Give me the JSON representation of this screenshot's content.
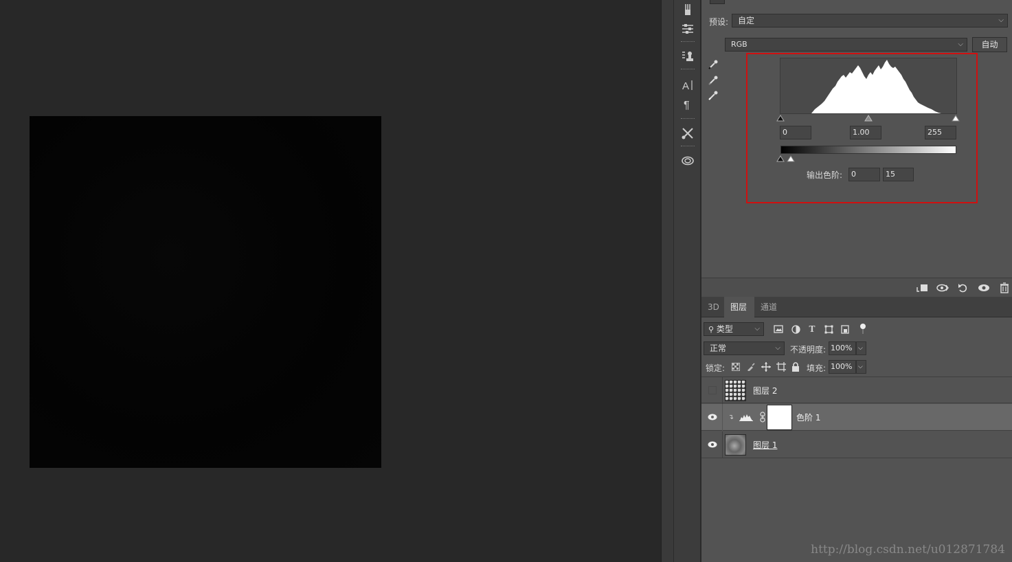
{
  "properties": {
    "preset_label": "预设:",
    "preset_value": "自定",
    "channel_value": "RGB",
    "auto_button": "自动",
    "input_black": "0",
    "input_gamma": "1.00",
    "input_white": "255",
    "output_label": "输出色阶:",
    "output_black": "0",
    "output_white": "15"
  },
  "layers_panel": {
    "tabs": [
      {
        "label": "3D"
      },
      {
        "label": "图层"
      },
      {
        "label": "通道"
      }
    ],
    "filter_label": "类型",
    "blend_mode": "正常",
    "opacity_label": "不透明度:",
    "opacity_value": "100%",
    "lock_label": "锁定:",
    "fill_label": "填充:",
    "fill_value": "100%",
    "layers": [
      {
        "name": "图层 2",
        "visible": false
      },
      {
        "name": "色阶 1",
        "visible": true,
        "selected": true
      },
      {
        "name": "图层 1",
        "visible": true
      }
    ]
  },
  "watermark": "http://blog.csdn.net/u012871784",
  "colors": {
    "highlight_box": "#d01010",
    "panel_bg": "#535353",
    "canvas_bg": "#282828"
  }
}
